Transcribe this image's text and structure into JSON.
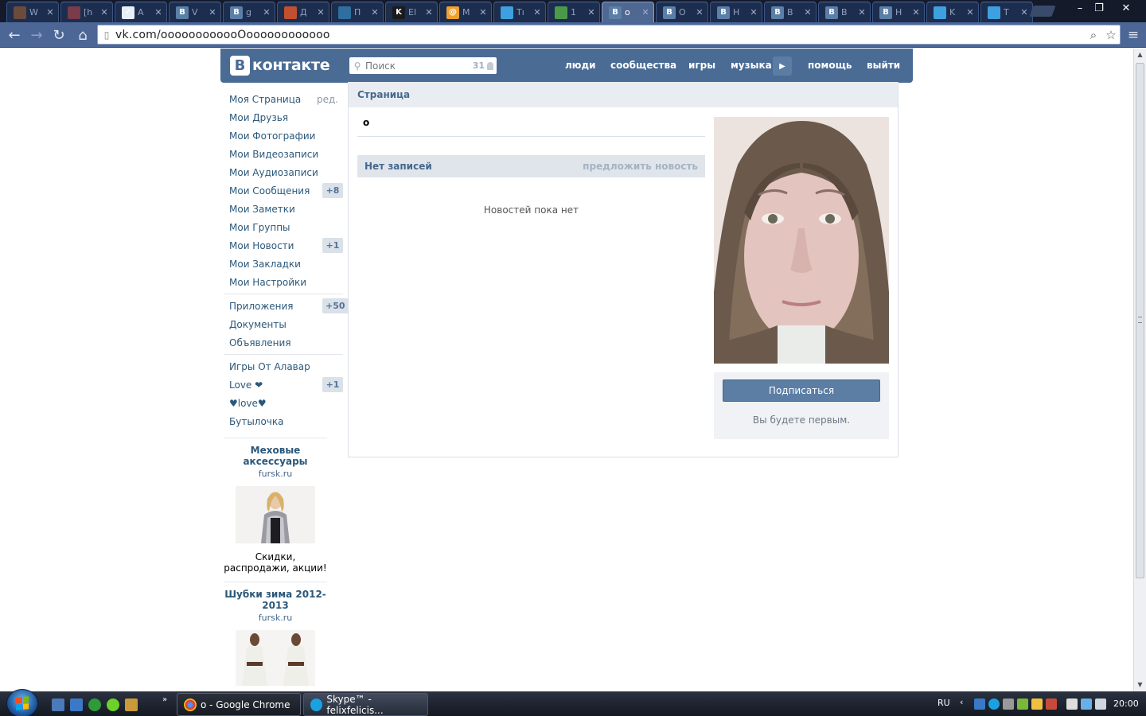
{
  "browser": {
    "tabs": [
      {
        "title": "W",
        "icon": "fan-art-icon",
        "color": "#6b4b3b",
        "glyph": ""
      },
      {
        "title": "[h",
        "icon": "fan-art-icon",
        "color": "#7a3b4b",
        "glyph": ""
      },
      {
        "title": "A",
        "icon": "checklist-icon",
        "color": "#e8eef6",
        "glyph": "✓"
      },
      {
        "title": "V",
        "icon": "vk-icon",
        "color": "#5b7fa6",
        "glyph": "B"
      },
      {
        "title": "g",
        "icon": "vk-icon",
        "color": "#5b7fa6",
        "glyph": "B"
      },
      {
        "title": "Д",
        "icon": "photo-icon",
        "color": "#c05030",
        "glyph": ""
      },
      {
        "title": "П",
        "icon": "document-icon",
        "color": "#2f6f9f",
        "glyph": ""
      },
      {
        "title": "El",
        "icon": "kinopoisk-icon",
        "color": "#1b1b1b",
        "glyph": "K"
      },
      {
        "title": "M",
        "icon": "mail-icon",
        "color": "#f0a030",
        "glyph": "@"
      },
      {
        "title": "Tı",
        "icon": "twitter-icon",
        "color": "#3fa0e0",
        "glyph": ""
      },
      {
        "title": "1",
        "icon": "ebook-icon",
        "color": "#4a9a4a",
        "glyph": ""
      },
      {
        "title": "o",
        "icon": "vk-icon",
        "color": "#5b7fa6",
        "glyph": "B",
        "active": true
      },
      {
        "title": "O",
        "icon": "vk-icon",
        "color": "#5b7fa6",
        "glyph": "B"
      },
      {
        "title": "H",
        "icon": "vk-icon",
        "color": "#5b7fa6",
        "glyph": "B"
      },
      {
        "title": "B",
        "icon": "vk-icon",
        "color": "#5b7fa6",
        "glyph": "B"
      },
      {
        "title": "B",
        "icon": "vk-icon",
        "color": "#5b7fa6",
        "glyph": "B"
      },
      {
        "title": "H",
        "icon": "vk-icon",
        "color": "#5b7fa6",
        "glyph": "B"
      },
      {
        "title": "K",
        "icon": "twitter-icon",
        "color": "#3fa0e0",
        "glyph": ""
      },
      {
        "title": "T",
        "icon": "twitter-icon",
        "color": "#3fa0e0",
        "glyph": ""
      }
    ],
    "url": "vk.com/oooooooooooOoooooooooooo"
  },
  "vk": {
    "logo_b": "B",
    "logo_word": "контакте",
    "search_placeholder": "Поиск",
    "online_count": "31",
    "nav": [
      "люди",
      "сообщества",
      "игры",
      "музыка",
      "помощь",
      "выйти"
    ],
    "menu": [
      {
        "label": "Моя Страница",
        "edit": "ред."
      },
      {
        "label": "Мои Друзья"
      },
      {
        "label": "Мои Фотографии"
      },
      {
        "label": "Мои Видеозаписи"
      },
      {
        "label": "Мои Аудиозаписи"
      },
      {
        "label": "Мои Сообщения",
        "counter": "+8"
      },
      {
        "label": "Мои Заметки"
      },
      {
        "label": "Мои Группы"
      },
      {
        "label": "Мои Новости",
        "counter": "+1"
      },
      {
        "label": "Мои Закладки"
      },
      {
        "label": "Мои Настройки"
      }
    ],
    "menu_apps": [
      {
        "label": "Приложения",
        "counter": "+50"
      },
      {
        "label": "Документы"
      },
      {
        "label": "Объявления"
      }
    ],
    "menu_extra": [
      {
        "label": "Игры От Алавар"
      },
      {
        "label": "Love ❤",
        "counter": "+1"
      },
      {
        "label": "♥love♥"
      },
      {
        "label": "Бутылочка"
      }
    ],
    "ads": [
      {
        "title": "Меховые аксессуары",
        "domain": "fursk.ru",
        "text": "Скидки, распродажи, акции!"
      },
      {
        "title": "Шубки зима 2012-2013",
        "domain": "fursk.ru"
      }
    ],
    "page_header": "Страница",
    "profile_name": "o",
    "wall_title": "Нет записей",
    "wall_suggest": "предложить новость",
    "wall_empty": "Новостей пока нет",
    "subscribe_label": "Подписаться",
    "subscribe_note": "Вы будете первым.",
    "colors": {
      "brand": "#4a6b94",
      "link": "#2b587a"
    }
  },
  "taskbar": {
    "tasks": [
      {
        "label": "o - Google Chrome",
        "icon": "chrome-icon"
      },
      {
        "label": "Skype™ - felixfelicis...",
        "icon": "skype-icon"
      }
    ],
    "lang": "RU",
    "time": "20:00"
  }
}
